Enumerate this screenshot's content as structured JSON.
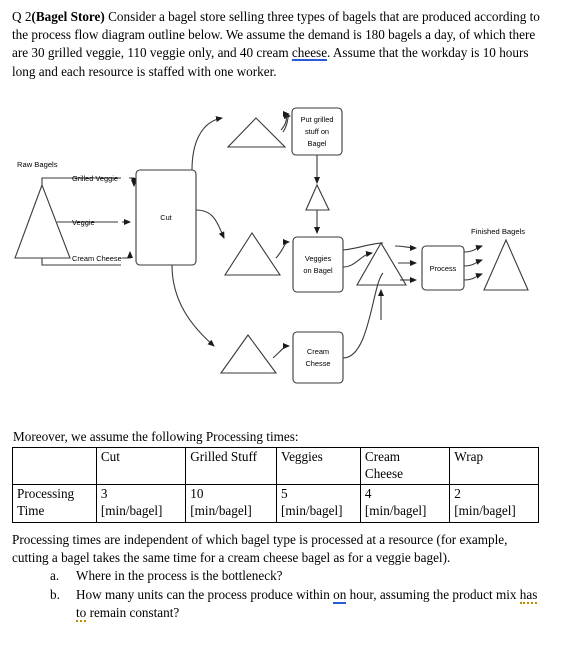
{
  "intro": {
    "q_number": "Q 2",
    "title_bold": "(Bagel Store)",
    "line1": " Consider a bagel store selling three types of bagels that are",
    "line2": "produced according to the process flow diagram outline below. We assume the",
    "line3": "demand is 180 bagels a day, of which there are 30 grilled veggie, 110 veggie only,",
    "line4a": "and 40 cream ",
    "line4_underlined": "cheese",
    "line4b": ". Assume that the workday is 10 hours long and each resource",
    "line5": "is staffed with one worker."
  },
  "diagram": {
    "raw_bagels_label": "Raw Bagels",
    "finished_bagels_label": "Finished Bagels",
    "flow_labels": {
      "grilled_veggie": "Grilled Veggie",
      "veggie": "Veggie",
      "cream_cheese": "Cream Cheese"
    },
    "boxes": {
      "cut": "Cut",
      "grilled_line1": "Put grilled",
      "grilled_line2": "stuff on",
      "grilled_line3": "Bagel",
      "veggies_line1": "Veggies",
      "veggies_line2": "on Bagel",
      "cream_line1": "Cream",
      "cream_line2": "Chesse",
      "process": "Process"
    }
  },
  "table_intro": "Moreover, we assume the following Processing times:",
  "table": {
    "headers": [
      "",
      "Cut",
      "Grilled Stuff",
      "Veggies",
      "Cream Cheese",
      "Wrap"
    ],
    "header_cream_line1": "Cream",
    "header_cream_line2": "Cheese",
    "row_label_line1": "Processing",
    "row_label_line2": "Time",
    "values": [
      "3",
      "10",
      "5",
      "4",
      "2"
    ],
    "unit": "[min/bagel]"
  },
  "closing": {
    "p_line1": "Processing times are independent of which bagel type is processed at a resource",
    "p_line2": "(for example, cutting a bagel takes the same time for a cream cheese bagel as for a",
    "p_line3": "veggie bagel).",
    "items": [
      {
        "marker": "a.",
        "text": "Where in the process is the bottleneck?"
      },
      {
        "marker": "b.",
        "text_a": "How many units can the process produce within ",
        "text_underlined": "on",
        "text_b": " hour, assuming the",
        "text_c": "product mix ",
        "text_spell": "has to",
        "text_d": " remain constant?"
      }
    ]
  },
  "colors": {
    "text": "#000000",
    "spell_blue": "#2a5bd7",
    "spell_gold": "#bf8f00",
    "diagram_stroke": "#3a3a3a",
    "background": "#ffffff"
  }
}
